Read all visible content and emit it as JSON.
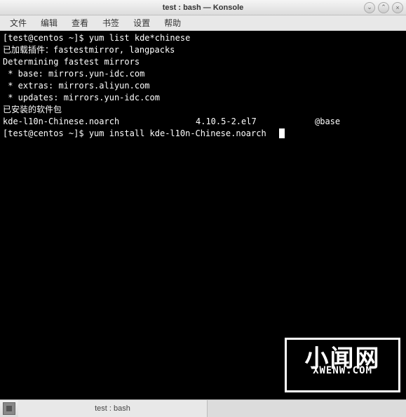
{
  "window": {
    "title": "test : bash — Konsole"
  },
  "menu": {
    "file": "文件",
    "edit": "编辑",
    "view": "查看",
    "bookmarks": "书签",
    "settings": "设置",
    "help": "帮助"
  },
  "terminal": {
    "prompt1_user": "[test@centos ~]$ ",
    "cmd1": "yum list kde*chinese",
    "line_plugins": "已加载插件：fastestmirror, langpacks",
    "line_determining": "Determining fastest mirrors",
    "line_base": " * base: mirrors.yun-idc.com",
    "line_extras": " * extras: mirrors.aliyun.com",
    "line_updates": " * updates: mirrors.yun-idc.com",
    "line_installed_header": "已安装的软件包",
    "pkg": {
      "name": "kde-l10n-Chinese.noarch",
      "version": "4.10.5-2.el7",
      "repo": "@base"
    },
    "prompt2_user": "[test@centos ~]$ ",
    "cmd2": "yum install kde-l10n-Chinese.noarch"
  },
  "watermark": {
    "big": "小闻网",
    "small": "XWENW.COM"
  },
  "statusbar": {
    "tab_label": "test : bash"
  }
}
